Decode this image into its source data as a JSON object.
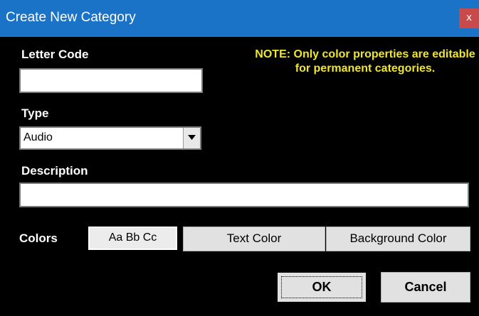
{
  "window": {
    "title": "Create New Category",
    "close_label": "x"
  },
  "form": {
    "letter_code": {
      "label": "Letter Code",
      "value": ""
    },
    "type": {
      "label": "Type",
      "selected": "Audio"
    },
    "description": {
      "label": "Description",
      "value": ""
    },
    "note": "NOTE: Only color properties are editable for permanent categories."
  },
  "colors": {
    "label": "Colors",
    "sample_text": "Aa Bb Cc",
    "text_color_button": "Text Color",
    "background_color_button": "Background Color"
  },
  "actions": {
    "ok_label": "OK",
    "cancel_label": "Cancel"
  },
  "theme": {
    "titlebar_color": "#1a73c7",
    "background_color": "#000000",
    "note_color": "#f0e62a",
    "close_button_color": "#c84a4a"
  }
}
